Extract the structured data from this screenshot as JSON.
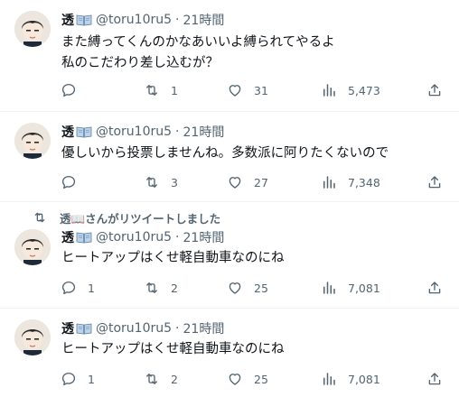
{
  "user": {
    "display_name": "透",
    "handle": "@toru10ru5",
    "time": "21時間"
  },
  "tweets": [
    {
      "text": "また縛ってくんのかなあいいよ縛られてやるよ\n私のこだわり差し込むが？",
      "replies": "",
      "retweets": "1",
      "likes": "31",
      "views": "5,473"
    },
    {
      "text": "優しいから投票しませんね。多数派に阿りたくないので",
      "replies": "",
      "retweets": "3",
      "likes": "27",
      "views": "7,348"
    },
    {
      "retweet_banner": "透📖さんがリツイートしました",
      "text": "ヒートアップはくせ軽自動車なのにね",
      "replies": "1",
      "retweets": "2",
      "likes": "25",
      "views": "7,081"
    },
    {
      "text": "ヒートアップはくせ軽自動車なのにね",
      "replies": "1",
      "retweets": "2",
      "likes": "25",
      "views": "7,081"
    }
  ],
  "icons": {
    "reply": "reply-icon",
    "retweet": "retweet-icon",
    "like": "heart-icon",
    "views": "views-chart-icon",
    "share": "share-icon",
    "name_badge": "open-book-icon"
  },
  "colors": {
    "text": "#0f1419",
    "secondary": "#536471",
    "divider": "#eff3f4"
  }
}
